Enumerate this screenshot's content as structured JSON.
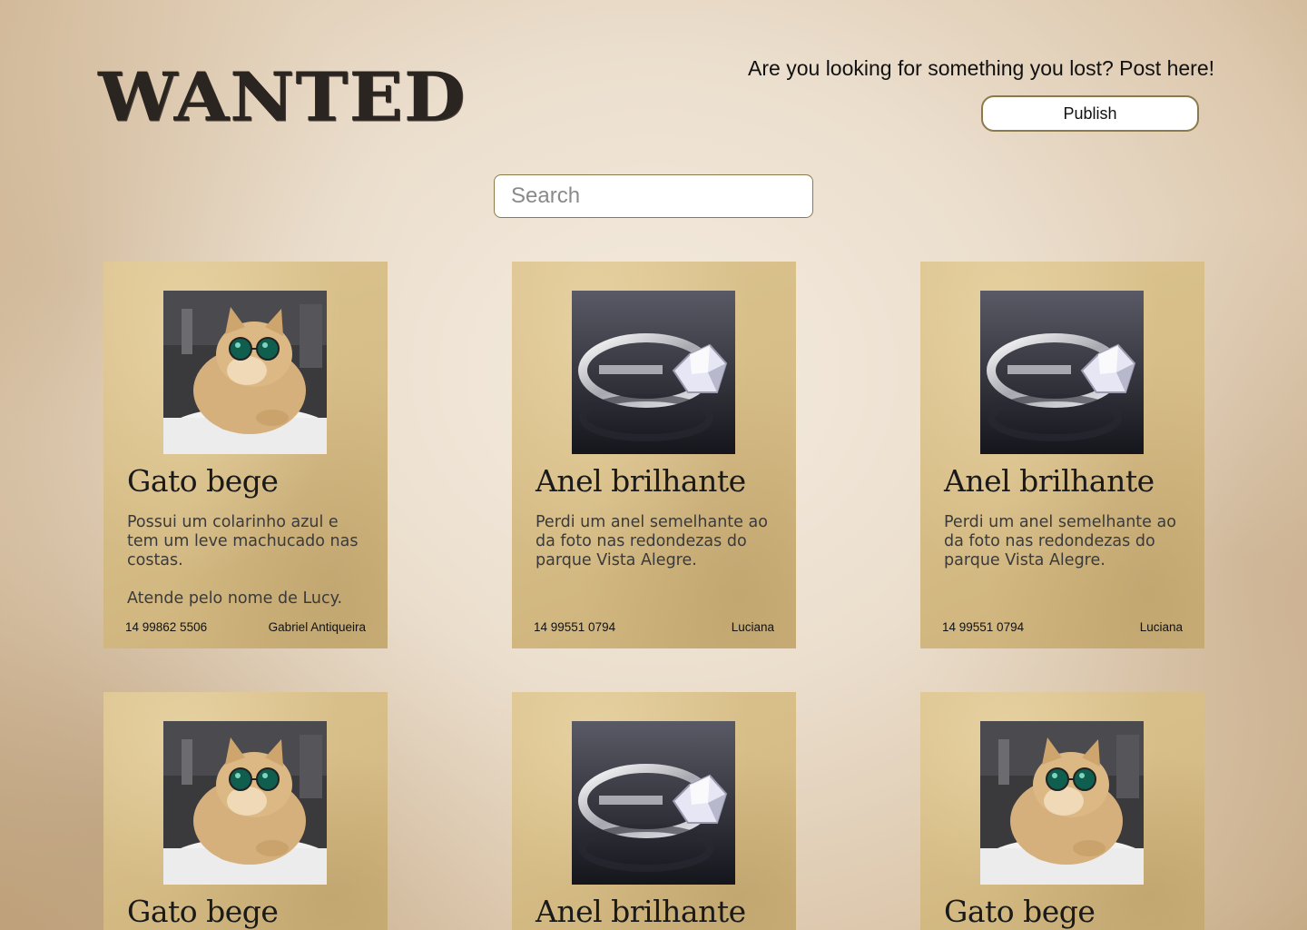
{
  "header": {
    "brand": "WANTED",
    "tagline": "Are you looking for something you lost? Post here!",
    "publish_label": "Publish"
  },
  "search": {
    "placeholder": "Search",
    "value": ""
  },
  "posts": [
    {
      "image": "cat-photo",
      "title": "Gato bege",
      "description": "Possui um colarinho azul e tem um leve machucado nas costas.\n\nAtende pelo nome de Lucy.",
      "phone": "14 99862 5506",
      "author": "Gabriel Antiqueira"
    },
    {
      "image": "ring-photo",
      "title": "Anel brilhante",
      "description": "Perdi um anel semelhante ao da foto nas redondezas do parque Vista Alegre.",
      "phone": "14 99551 0794",
      "author": "Luciana"
    },
    {
      "image": "ring-photo",
      "title": "Anel brilhante",
      "description": "Perdi um anel semelhante ao da foto nas redondezas do parque Vista Alegre.",
      "phone": "14 99551 0794",
      "author": "Luciana"
    },
    {
      "image": "cat-photo",
      "title": "Gato bege"
    },
    {
      "image": "ring-photo",
      "title": "Anel brilhante"
    },
    {
      "image": "cat-photo",
      "title": "Gato bege"
    }
  ]
}
